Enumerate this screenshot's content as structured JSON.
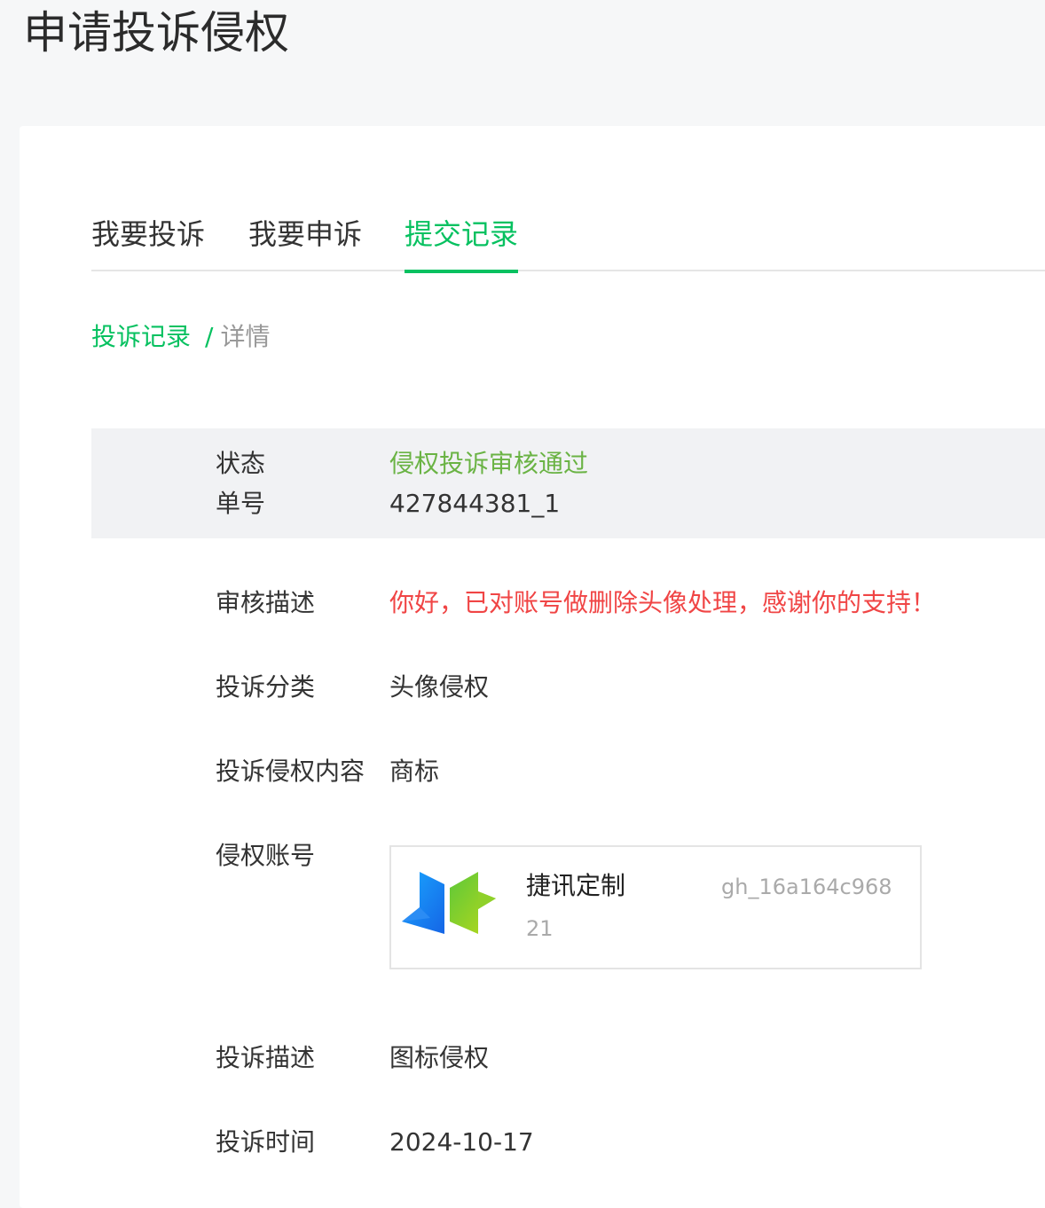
{
  "page": {
    "title": "申请投诉侵权"
  },
  "tabs": [
    {
      "label": "我要投诉",
      "active": false
    },
    {
      "label": "我要申诉",
      "active": false
    },
    {
      "label": "提交记录",
      "active": true
    }
  ],
  "breadcrumb": {
    "parent": "投诉记录",
    "separator": "/",
    "current": "详情"
  },
  "summary": {
    "status_label": "状态",
    "status_value": "侵权投诉审核通过",
    "order_label": "单号",
    "order_value": "427844381_1"
  },
  "details": {
    "review_desc_label": "审核描述",
    "review_desc_value": "你好，已对账号做删除头像处理，感谢你的支持！",
    "category_label": "投诉分类",
    "category_value": "头像侵权",
    "content_label": "投诉侵权内容",
    "content_value": "商标",
    "account_label": "侵权账号",
    "complaint_desc_label": "投诉描述",
    "complaint_desc_value": "图标侵权",
    "time_label": "投诉时间",
    "time_value": "2024-10-17"
  },
  "account": {
    "name": "捷讯定制",
    "id": "gh_16a164c968",
    "count": "21",
    "logo_icon": "brand-logo-icon"
  },
  "colors": {
    "accent": "#07c160",
    "status_green": "#6ab344",
    "alert_red": "#f04545"
  }
}
